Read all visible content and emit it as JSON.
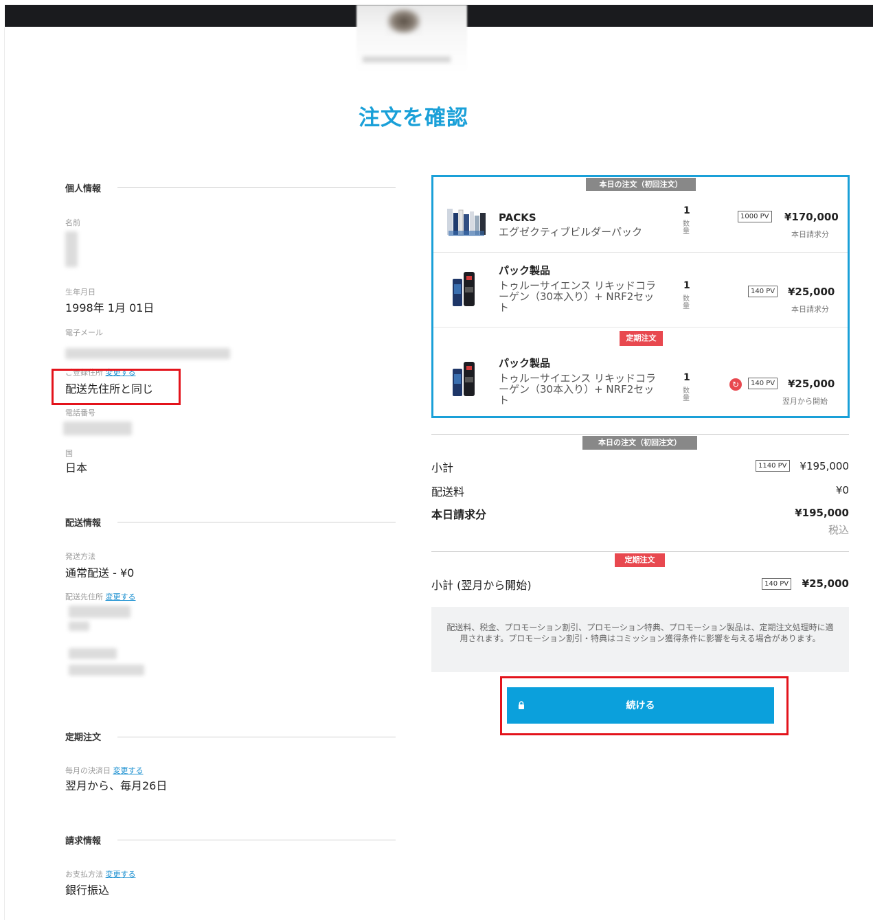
{
  "page": {
    "title": "注文を確認"
  },
  "personal": {
    "section_title": "個人情報",
    "name_label": "名前",
    "dob_label": "生年月日",
    "dob_value": "1998年 1月 01日",
    "email_label": "電子メール",
    "registered_address_label": "ご登録住所",
    "change_label": "変更する",
    "registered_address_value": "配送先住所と同じ",
    "phone_label": "電話番号",
    "country_label": "国",
    "country_value": "日本"
  },
  "shipping": {
    "section_title": "配送情報",
    "method_label": "発送方法",
    "method_value": "通常配送 - ¥0",
    "address_label": "配送先住所",
    "change_label": "変更する"
  },
  "subscription": {
    "section_title": "定期注文",
    "billing_day_label": "毎月の決済日",
    "change_label": "変更する",
    "billing_day_value": "翌月から、毎月26日"
  },
  "billing": {
    "section_title": "請求情報",
    "payment_label": "お支払方法",
    "change_label": "変更する",
    "payment_value": "銀行振込"
  },
  "cart": {
    "today_tag": "本日の注文（初回注文）",
    "recurring_tag": "定期注文",
    "qty_label": "数量",
    "items": [
      {
        "category": "PACKS",
        "name": "エグゼクティブビルダーパック",
        "qty": "1",
        "pv": "1000 PV",
        "price": "¥170,000",
        "note": "本日請求分"
      },
      {
        "category": "パック製品",
        "name": "トゥルーサイエンス リキッドコラーゲン（30本入り）+ NRF2セット",
        "qty": "1",
        "pv": "140 PV",
        "price": "¥25,000",
        "note": "本日請求分"
      },
      {
        "category": "パック製品",
        "name": "トゥルーサイエンス リキッドコラーゲン（30本入り）+ NRF2セット",
        "qty": "1",
        "pv": "140 PV",
        "price": "¥25,000",
        "note": "翌月から開始"
      }
    ]
  },
  "summary": {
    "today_tag": "本日の注文（初回注文）",
    "subtotal_label": "小計",
    "subtotal_pv": "1140 PV",
    "subtotal_value": "¥195,000",
    "shipping_label": "配送料",
    "shipping_value": "¥0",
    "due_today_label": "本日請求分",
    "due_today_value": "¥195,000",
    "tax_note": "税込",
    "recurring_tag": "定期注文",
    "recurring_subtotal_label": "小計 (翌月から開始)",
    "recurring_pv": "140 PV",
    "recurring_value": "¥25,000",
    "notice": "配送料、税金、プロモーション割引、プロモーション特典、プロモーション製品は、定期注文処理時に適用されます。プロモーション割引・特典はコミッション獲得条件に影響を与える場合があります。"
  },
  "actions": {
    "continue_label": "続ける"
  },
  "colors": {
    "accent": "#1aa0d8",
    "button": "#0ba0dc",
    "highlight": "#e3131b",
    "recurring": "#e8484f",
    "header": "#1a1b1e"
  }
}
